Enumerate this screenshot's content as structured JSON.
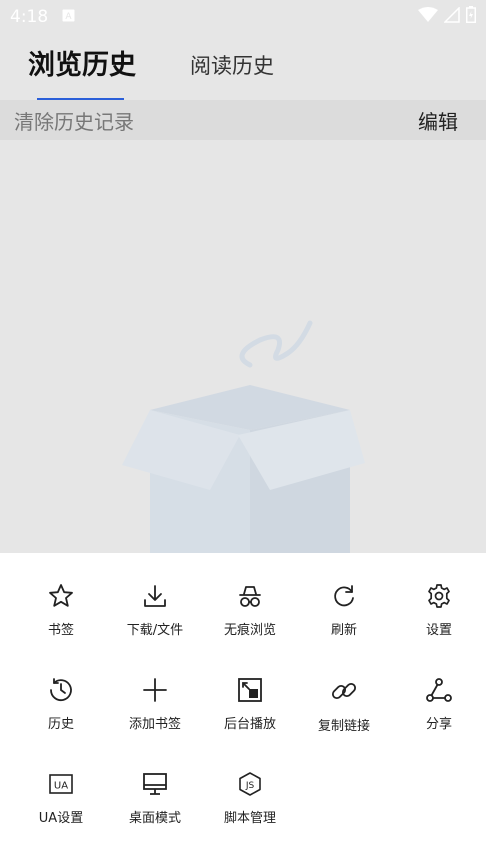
{
  "status_bar": {
    "time": "4:18",
    "notification_icon": "a-notification-icon",
    "wifi_icon": "wifi-icon",
    "signal_icon": "signal-icon",
    "battery_icon": "battery-icon"
  },
  "tabs": [
    {
      "label": "浏览历史",
      "active": true
    },
    {
      "label": "阅读历史",
      "active": false
    }
  ],
  "actions": {
    "clear_label": "清除历史记录",
    "edit_label": "编辑"
  },
  "empty_state": {
    "icon": "empty-box-illustration"
  },
  "menu": {
    "items": [
      {
        "label": "书签",
        "icon": "star-icon"
      },
      {
        "label": "下载/文件",
        "icon": "download-icon"
      },
      {
        "label": "无痕浏览",
        "icon": "incognito-icon"
      },
      {
        "label": "刷新",
        "icon": "refresh-icon"
      },
      {
        "label": "设置",
        "icon": "gear-icon"
      },
      {
        "label": "历史",
        "icon": "history-icon"
      },
      {
        "label": "添加书签",
        "icon": "plus-icon"
      },
      {
        "label": "后台播放",
        "icon": "background-play-icon"
      },
      {
        "label": "复制链接",
        "icon": "link-icon"
      },
      {
        "label": "分享",
        "icon": "share-icon"
      },
      {
        "label": "UA设置",
        "icon": "ua-icon"
      },
      {
        "label": "桌面模式",
        "icon": "desktop-icon"
      },
      {
        "label": "脚本管理",
        "icon": "js-icon"
      }
    ]
  },
  "colors": {
    "background": "#e6e6e6",
    "tab_underline": "#2b5fd9",
    "sheet": "#ffffff"
  }
}
